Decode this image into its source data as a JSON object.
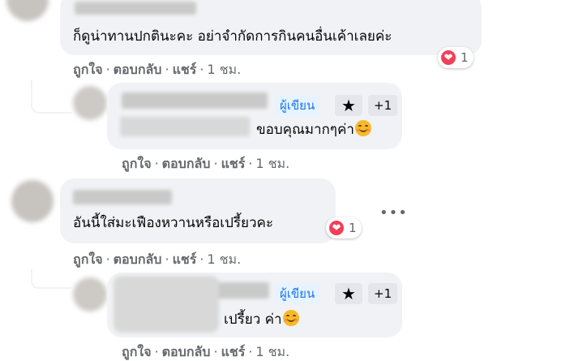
{
  "actions": {
    "like": "ถูกใจ",
    "reply": "ตอบกลับ",
    "share": "แชร์",
    "separator": "·"
  },
  "comments": [
    {
      "text": "ก็ดูน่าทานปกตินะคะ อย่าจำกัดการกินคนอื่นเค้าเลยค่ะ",
      "reaction_count": "1",
      "time": "1 ชม."
    },
    {
      "badge": "ผู้เขียน",
      "badge_extra": "+1",
      "text": "ขอบคุณมากๆค่า",
      "time": "1 ชม."
    },
    {
      "text": "อันนี้ใส่มะเฟืองหวานหรือเปรี้ยวคะ",
      "reaction_count": "1",
      "time": "1 ชม.",
      "more": "•••"
    },
    {
      "badge": "ผู้เขียน",
      "badge_extra": "+1",
      "text": "เปรี้ยว ค่า",
      "time": "1 ชม."
    }
  ],
  "icons": {
    "reaction": "heart-icon",
    "star": "star-icon",
    "emoji": "smiling-face-icon"
  },
  "colors": {
    "bubble": "#f0f2f5",
    "heart": "#f33e58",
    "author_badge_text": "#1877f2",
    "author_badge_bg": "#e7f3ff"
  }
}
